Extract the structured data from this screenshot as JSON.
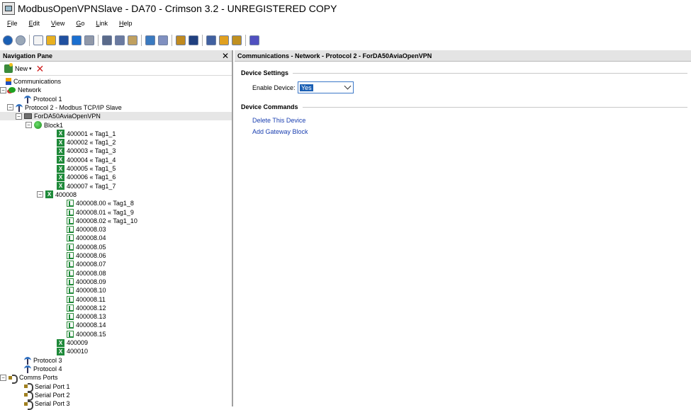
{
  "window": {
    "title": "ModbusOpenVPNSlave - DA70 - Crimson 3.2 - UNREGISTERED COPY"
  },
  "menu": [
    {
      "ul": "F",
      "rest": "ile"
    },
    {
      "ul": "E",
      "rest": "dit"
    },
    {
      "ul": "V",
      "rest": "iew"
    },
    {
      "ul": "G",
      "rest": "o"
    },
    {
      "ul": "L",
      "rest": "ink"
    },
    {
      "ul": "H",
      "rest": "elp"
    }
  ],
  "toolbar_icons": [
    "back-icon",
    "forward-icon",
    "new-file-icon",
    "open-folder-icon",
    "save-icon",
    "import-icon",
    "export-icon",
    "cut-icon",
    "copy-icon",
    "paste-icon",
    "network-icon",
    "find-icon",
    "link-icon",
    "monitor-icon",
    "send-icon",
    "globe-icon",
    "lock-icon",
    "wand-icon"
  ],
  "nav": {
    "header": "Navigation Pane",
    "new_label": "New",
    "tree": [
      {
        "label": "Communications",
        "level": 0,
        "icon": "comms",
        "exp": ""
      },
      {
        "label": "Network",
        "level": 0,
        "icon": "net",
        "exp": "−"
      },
      {
        "label": "Protocol 1",
        "level": 2,
        "icon": "proto",
        "exp": ""
      },
      {
        "label": "Protocol 2 - Modbus TCP/IP Slave",
        "level": 1,
        "icon": "proto",
        "exp": "−"
      },
      {
        "label": "ForDA50AviaOpenVPN",
        "level": 2,
        "icon": "device",
        "exp": "−",
        "selected": true
      },
      {
        "label": "Block1",
        "level": 3,
        "icon": "block",
        "exp": "−"
      },
      {
        "label": "400001 « Tag1_1",
        "level": 5,
        "icon": "x",
        "exp": ""
      },
      {
        "label": "400002 « Tag1_2",
        "level": 5,
        "icon": "x",
        "exp": ""
      },
      {
        "label": "400003 « Tag1_3",
        "level": 5,
        "icon": "x",
        "exp": ""
      },
      {
        "label": "400004 « Tag1_4",
        "level": 5,
        "icon": "x",
        "exp": ""
      },
      {
        "label": "400005 « Tag1_5",
        "level": 5,
        "icon": "x",
        "exp": ""
      },
      {
        "label": "400006 « Tag1_6",
        "level": 5,
        "icon": "x",
        "exp": ""
      },
      {
        "label": "400007 « Tag1_7",
        "level": 5,
        "icon": "x",
        "exp": ""
      },
      {
        "label": "400008",
        "level": 4,
        "icon": "x",
        "exp": "−"
      },
      {
        "label": "400008.00 « Tag1_8",
        "level": 6,
        "icon": "bit",
        "exp": ""
      },
      {
        "label": "400008.01 « Tag1_9",
        "level": 6,
        "icon": "bit",
        "exp": ""
      },
      {
        "label": "400008.02 « Tag1_10",
        "level": 6,
        "icon": "bit",
        "exp": ""
      },
      {
        "label": "400008.03",
        "level": 6,
        "icon": "bit",
        "exp": ""
      },
      {
        "label": "400008.04",
        "level": 6,
        "icon": "bit",
        "exp": ""
      },
      {
        "label": "400008.05",
        "level": 6,
        "icon": "bit",
        "exp": ""
      },
      {
        "label": "400008.06",
        "level": 6,
        "icon": "bit",
        "exp": ""
      },
      {
        "label": "400008.07",
        "level": 6,
        "icon": "bit",
        "exp": ""
      },
      {
        "label": "400008.08",
        "level": 6,
        "icon": "bit",
        "exp": ""
      },
      {
        "label": "400008.09",
        "level": 6,
        "icon": "bit",
        "exp": ""
      },
      {
        "label": "400008.10",
        "level": 6,
        "icon": "bit",
        "exp": ""
      },
      {
        "label": "400008.11",
        "level": 6,
        "icon": "bit",
        "exp": ""
      },
      {
        "label": "400008.12",
        "level": 6,
        "icon": "bit",
        "exp": ""
      },
      {
        "label": "400008.13",
        "level": 6,
        "icon": "bit",
        "exp": ""
      },
      {
        "label": "400008.14",
        "level": 6,
        "icon": "bit",
        "exp": ""
      },
      {
        "label": "400008.15",
        "level": 6,
        "icon": "bit",
        "exp": ""
      },
      {
        "label": "400009",
        "level": 5,
        "icon": "x",
        "exp": ""
      },
      {
        "label": "400010",
        "level": 5,
        "icon": "x",
        "exp": ""
      },
      {
        "label": "Protocol 3",
        "level": 2,
        "icon": "proto",
        "exp": ""
      },
      {
        "label": "Protocol 4",
        "level": 2,
        "icon": "proto",
        "exp": ""
      },
      {
        "label": "Comms Ports",
        "level": 0,
        "icon": "port",
        "exp": "−"
      },
      {
        "label": "Serial Port 1",
        "level": 2,
        "icon": "port",
        "exp": ""
      },
      {
        "label": "Serial Port 2",
        "level": 2,
        "icon": "port",
        "exp": ""
      },
      {
        "label": "Serial Port 3",
        "level": 2,
        "icon": "port",
        "exp": ""
      }
    ]
  },
  "detail": {
    "header": "Communications - Network - Protocol 2 - ForDA50AviaOpenVPN",
    "device_settings_title": "Device Settings",
    "enable_device_label": "Enable Device:",
    "enable_device_value": "Yes",
    "device_commands_title": "Device Commands",
    "commands": [
      "Delete This Device",
      "Add Gateway Block"
    ]
  }
}
